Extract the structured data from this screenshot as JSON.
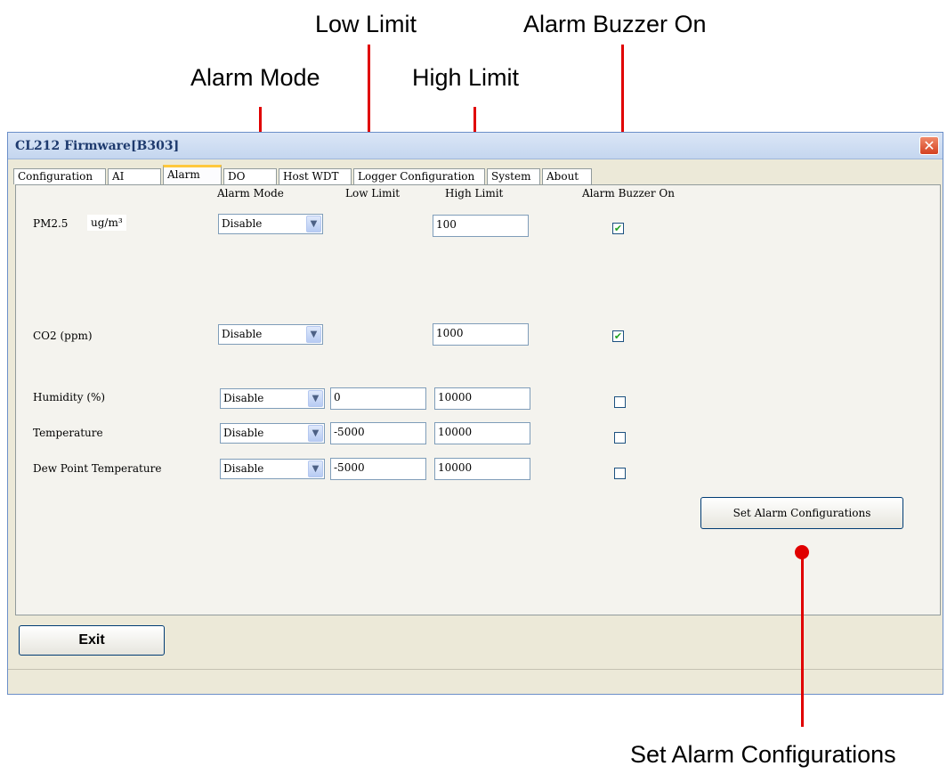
{
  "window": {
    "title": "CL212 Firmware[B303]"
  },
  "tabs": [
    {
      "label": "Configuration"
    },
    {
      "label": "AI"
    },
    {
      "label": "Alarm"
    },
    {
      "label": "DO"
    },
    {
      "label": "Host WDT"
    },
    {
      "label": "Logger Configuration"
    },
    {
      "label": "System"
    },
    {
      "label": "About"
    }
  ],
  "columns": {
    "mode": "Alarm Mode",
    "low": "Low Limit",
    "high": "High Limit",
    "buzzer": "Alarm Buzzer On"
  },
  "rows": [
    {
      "label": "PM2.5",
      "unit": "ug/m³",
      "mode": "Disable",
      "high": "100",
      "buzzer": true
    },
    {
      "label": "CO2 (ppm)",
      "mode": "Disable",
      "high": "1000",
      "buzzer": true
    },
    {
      "label": "Humidity (%)",
      "mode": "Disable",
      "low": "0",
      "high": "10000",
      "buzzer": false
    },
    {
      "label": "Temperature",
      "mode": "Disable",
      "low": "-5000",
      "high": "10000",
      "buzzer": false
    },
    {
      "label": "Dew Point Temperature",
      "mode": "Disable",
      "low": "-5000",
      "high": "10000",
      "buzzer": false
    }
  ],
  "buttons": {
    "set_alarm": "Set Alarm Configurations",
    "exit": "Exit"
  },
  "annotations": {
    "alarm_mode": "Alarm Mode",
    "low_limit": "Low Limit",
    "high_limit": "High Limit",
    "alarm_buzzer": "Alarm Buzzer On",
    "set_alarm": "Set Alarm Configurations"
  },
  "colors": {
    "annotation": "#e00000",
    "active_tab_highlight": "#ffc83c"
  }
}
